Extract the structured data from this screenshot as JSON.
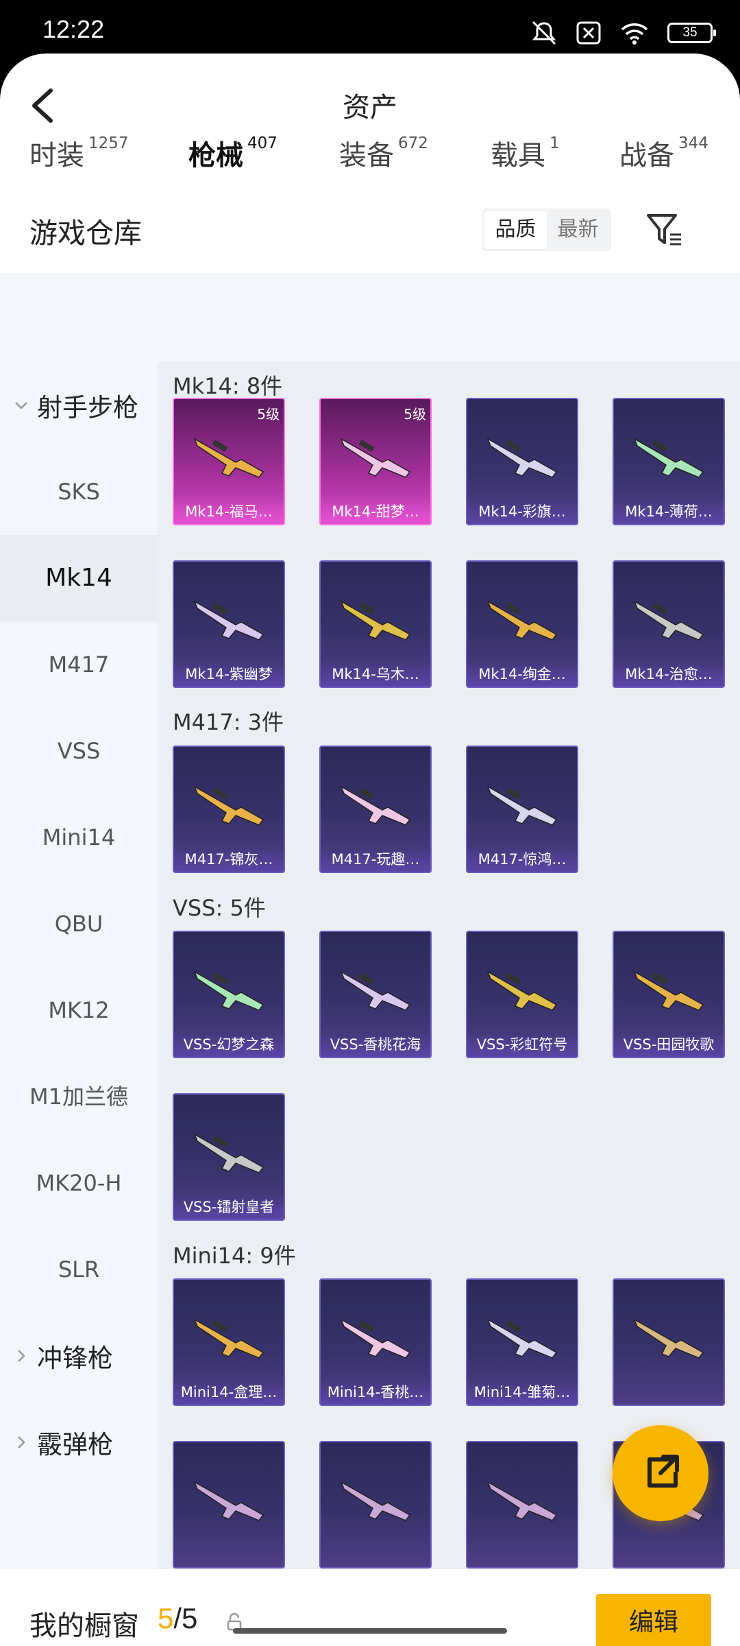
{
  "status": {
    "time": "12:22",
    "battery": "35"
  },
  "header": {
    "title": "资产"
  },
  "section": {
    "title": "游戏仓库"
  },
  "sort": {
    "options": [
      "品质",
      "最新"
    ]
  },
  "tabs": [
    {
      "label": "时装",
      "count": "1257"
    },
    {
      "label": "枪械",
      "count": "407"
    },
    {
      "label": "装备",
      "count": "672"
    },
    {
      "label": "载具",
      "count": "1"
    },
    {
      "label": "战备",
      "count": "344"
    }
  ],
  "sidebar": {
    "group_open": "射手步枪",
    "items": [
      "SKS",
      "Mk14",
      "M417",
      "VSS",
      "Mini14",
      "QBU",
      "MK12",
      "M1加兰德",
      "MK20-H",
      "SLR"
    ],
    "group_smg": "冲锋枪",
    "group_shotgun": "霰弹枪"
  },
  "groups": [
    {
      "title": "Mk14: 8件",
      "items": [
        {
          "name": "Mk14-福马…",
          "level": "5级"
        },
        {
          "name": "Mk14-甜梦…",
          "level": "5级"
        },
        {
          "name": "Mk14-彩旗…"
        },
        {
          "name": "Mk14-薄荷…"
        },
        {
          "name": "Mk14-紫幽梦"
        },
        {
          "name": "Mk14-乌木…"
        },
        {
          "name": "Mk14-绚金…"
        },
        {
          "name": "Mk14-治愈…"
        }
      ]
    },
    {
      "title": "M417: 3件",
      "items": [
        {
          "name": "M417-锦灰…"
        },
        {
          "name": "M417-玩趣…"
        },
        {
          "name": "M417-惊鸿…"
        }
      ]
    },
    {
      "title": "VSS: 5件",
      "items": [
        {
          "name": "VSS-幻梦之森"
        },
        {
          "name": "VSS-香桃花海"
        },
        {
          "name": "VSS-彩虹符号"
        },
        {
          "name": "VSS-田园牧歌"
        },
        {
          "name": "VSS-镭射皇者"
        }
      ]
    },
    {
      "title": "Mini14: 9件",
      "items": [
        {
          "name": "Mini14-盒理…"
        },
        {
          "name": "Mini14-香桃…"
        },
        {
          "name": "Mini14-雏菊…"
        }
      ]
    }
  ],
  "bottom": {
    "label": "我的橱窗",
    "count_used": "5",
    "count_total": "/5",
    "edit_label": "编辑"
  }
}
